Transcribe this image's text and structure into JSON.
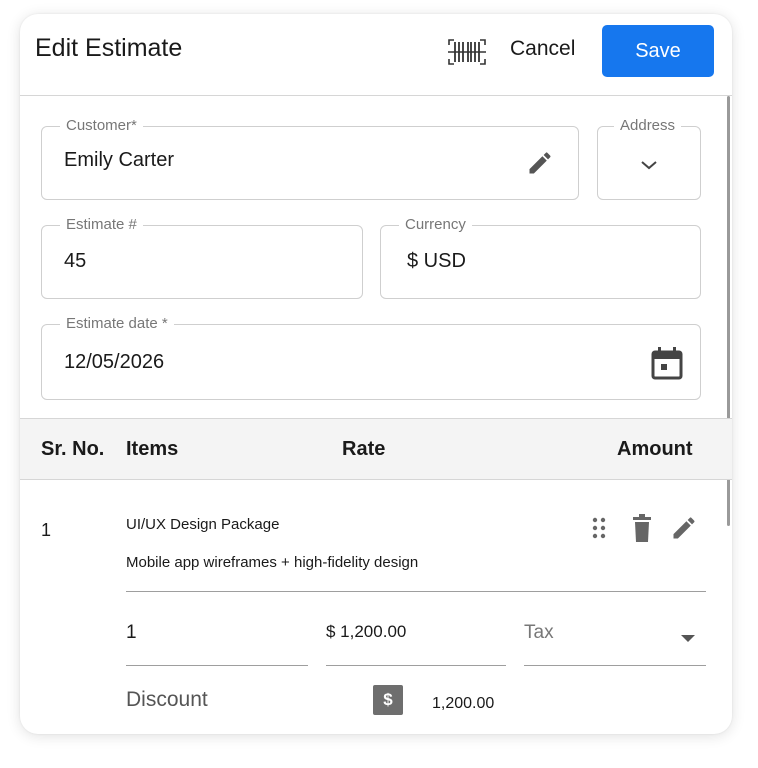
{
  "header": {
    "title": "Edit Estimate",
    "cancel_label": "Cancel",
    "save_label": "Save",
    "accent_color": "#1677ee"
  },
  "form": {
    "customer": {
      "label": "Customer*",
      "value": "Emily Carter",
      "icon": "pencil-icon"
    },
    "address": {
      "label": "Address",
      "icon": "chevron-down-icon"
    },
    "estimate_number": {
      "label": "Estimate #",
      "value": "45"
    },
    "currency": {
      "label": "Currency",
      "value": "$ USD"
    },
    "estimate_date": {
      "label": "Estimate date *",
      "value": "12/05/2026",
      "icon": "calendar-icon"
    }
  },
  "table": {
    "columns": [
      "Sr. No.",
      "Items",
      "Rate",
      "Amount"
    ],
    "rows": [
      {
        "sr_no": "1",
        "name": "UI/UX Design Package",
        "description": "Mobile app wireframes + high-fidelity design",
        "quantity": "1",
        "rate": "$ 1,200.00",
        "tax_placeholder": "Tax",
        "discount_label": "Discount",
        "discount_type_symbol": "$",
        "amount": "1,200.00",
        "icons": [
          "drag-handle-icon",
          "trash-icon",
          "pencil-icon"
        ]
      }
    ]
  }
}
